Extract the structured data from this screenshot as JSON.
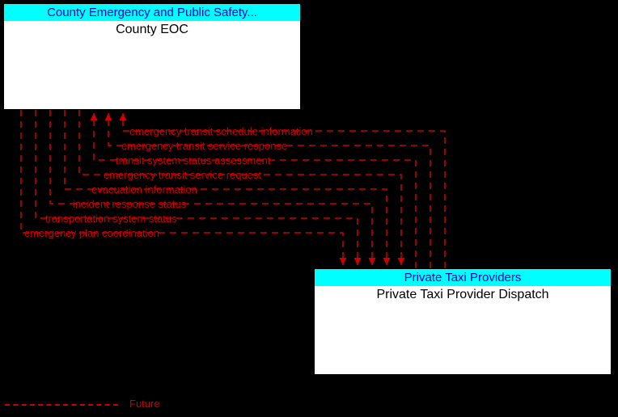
{
  "boxes": {
    "eoc": {
      "header": "County Emergency and Public Safety...",
      "title": "County EOC"
    },
    "taxi": {
      "header": "Private Taxi Providers",
      "title": "Private Taxi Provider Dispatch"
    }
  },
  "flows": [
    "emergency transit schedule information",
    "emergency transit service response",
    "transit system status assessment",
    "emergency transit service request",
    "evacuation information",
    "incident response status",
    "transportation system status",
    "emergency plan coordination"
  ],
  "legend": {
    "future": "Future"
  },
  "chart_data": {
    "type": "diagram",
    "title": "Information Flow Diagram",
    "nodes": [
      {
        "id": "county_eoc",
        "group": "County Emergency and Public Safety...",
        "label": "County EOC"
      },
      {
        "id": "private_taxi_dispatch",
        "group": "Private Taxi Providers",
        "label": "Private Taxi Provider Dispatch"
      }
    ],
    "edges": [
      {
        "from": "private_taxi_dispatch",
        "to": "county_eoc",
        "label": "emergency transit schedule information",
        "status": "Future"
      },
      {
        "from": "private_taxi_dispatch",
        "to": "county_eoc",
        "label": "emergency transit service response",
        "status": "Future"
      },
      {
        "from": "private_taxi_dispatch",
        "to": "county_eoc",
        "label": "transit system status assessment",
        "status": "Future"
      },
      {
        "from": "county_eoc",
        "to": "private_taxi_dispatch",
        "label": "emergency transit service request",
        "status": "Future"
      },
      {
        "from": "county_eoc",
        "to": "private_taxi_dispatch",
        "label": "evacuation information",
        "status": "Future"
      },
      {
        "from": "county_eoc",
        "to": "private_taxi_dispatch",
        "label": "incident response status",
        "status": "Future"
      },
      {
        "from": "county_eoc",
        "to": "private_taxi_dispatch",
        "label": "transportation system status",
        "status": "Future"
      },
      {
        "from": "county_eoc",
        "to": "private_taxi_dispatch",
        "label": "emergency plan coordination",
        "status": "Future"
      }
    ],
    "legend": [
      {
        "style": "dashed-red",
        "label": "Future"
      }
    ]
  }
}
